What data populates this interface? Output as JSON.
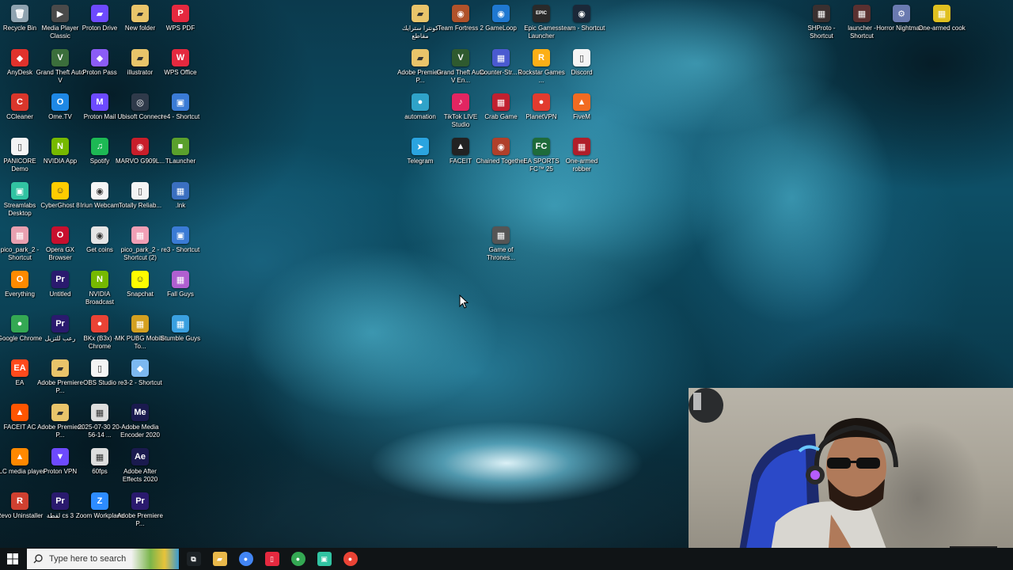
{
  "desktop": {
    "icons": [
      {
        "label": "Recycle Bin",
        "glyph": "🗑",
        "color": "#8fa3b0"
      },
      {
        "label": "AnyDesk",
        "glyph": "◆",
        "color": "#e0322c"
      },
      {
        "label": "CCleaner",
        "glyph": "C",
        "color": "#d9362b"
      },
      {
        "label": "PANICORE Demo",
        "glyph": "▯",
        "color": "#f4f4f4"
      },
      {
        "label": "Streamlabs Desktop",
        "glyph": "▣",
        "color": "#31c3a2"
      },
      {
        "label": "pico_park_2 - Shortcut",
        "glyph": "▦",
        "color": "#e8a0b0"
      },
      {
        "label": "Everything",
        "glyph": "O",
        "color": "#ff8a00"
      },
      {
        "label": "Google Chrome",
        "glyph": "●",
        "color": "#34a853"
      },
      {
        "label": "EA",
        "glyph": "EA",
        "color": "#ff4a1c"
      },
      {
        "label": "FACEIT AC",
        "glyph": "▲",
        "color": "#ff5500"
      },
      {
        "label": "VLC media player",
        "glyph": "▲",
        "color": "#ff8800"
      },
      {
        "label": "Revo Uninstaller",
        "glyph": "R",
        "color": "#d04030"
      },
      {
        "label": "Media Player Classic",
        "glyph": "▶",
        "color": "#4a4a4a"
      },
      {
        "label": "Grand Theft Auto V",
        "glyph": "V",
        "color": "#3b6e3b"
      },
      {
        "label": "Ome.TV",
        "glyph": "O",
        "color": "#1e88e5"
      },
      {
        "label": "NVIDIA App",
        "glyph": "N",
        "color": "#76b900"
      },
      {
        "label": "CyberGhost 8",
        "glyph": "☺",
        "color": "#ffcc00"
      },
      {
        "label": "Opera GX Browser",
        "glyph": "O",
        "color": "#c8102e"
      },
      {
        "label": "Untitled",
        "glyph": "Pr",
        "color": "#2a1a6e"
      },
      {
        "label": "رعب للتزيل",
        "glyph": "Pr",
        "color": "#2a1a6e"
      },
      {
        "label": "Adobe Premiere P...",
        "glyph": "▰",
        "color": "#e9c46a"
      },
      {
        "label": "Adobe Premiere P...",
        "glyph": "▰",
        "color": "#e9c46a"
      },
      {
        "label": "Proton VPN",
        "glyph": "▼",
        "color": "#6d4aff"
      },
      {
        "label": "لقطة cs 3",
        "glyph": "Pr",
        "color": "#2a1a6e"
      },
      {
        "label": "Proton Drive",
        "glyph": "▰",
        "color": "#6d4aff"
      },
      {
        "label": "Proton Pass",
        "glyph": "◆",
        "color": "#8b5cf6"
      },
      {
        "label": "Proton Mail",
        "glyph": "M",
        "color": "#6d4aff"
      },
      {
        "label": "Spotify",
        "glyph": "♫",
        "color": "#1db954"
      },
      {
        "label": "Iriun Webcam",
        "glyph": "◉",
        "color": "#f5f5f5"
      },
      {
        "label": "Get coins",
        "glyph": "◉",
        "color": "#e5e5e5"
      },
      {
        "label": "NVIDIA Broadcast",
        "glyph": "N",
        "color": "#76b900"
      },
      {
        "label": "BKx (B3x) - Chrome",
        "glyph": "●",
        "color": "#ea4335"
      },
      {
        "label": "OBS Studio",
        "glyph": "▯",
        "color": "#f4f4f4"
      },
      {
        "label": "2025-07-30 20-56-14 ...",
        "glyph": "▦",
        "color": "#dddddd"
      },
      {
        "label": "60fps",
        "glyph": "▦",
        "color": "#dddddd"
      },
      {
        "label": "Zoom Workplace",
        "glyph": "Z",
        "color": "#2d8cff"
      },
      {
        "label": "New folder",
        "glyph": "▰",
        "color": "#e9c46a"
      },
      {
        "label": "illustrator",
        "glyph": "▰",
        "color": "#e9c46a"
      },
      {
        "label": "Ubisoft Connect",
        "glyph": "◎",
        "color": "#2f3a4a"
      },
      {
        "label": "MARVO G909L...",
        "glyph": "◉",
        "color": "#c81e2a"
      },
      {
        "label": "Totally Reliab...",
        "glyph": "▯",
        "color": "#f4f4f4"
      },
      {
        "label": "pico_park_2 - Shortcut (2)",
        "glyph": "▦",
        "color": "#f19fb5"
      },
      {
        "label": "Snapchat",
        "glyph": "☺",
        "color": "#fffc00"
      },
      {
        "label": "MK PUBG Mobile To...",
        "glyph": "▦",
        "color": "#d4a020"
      },
      {
        "label": "re3-2 - Shortcut",
        "glyph": "◆",
        "color": "#7cb8f0"
      },
      {
        "label": "Adobe Media Encoder 2020",
        "glyph": "Me",
        "color": "#1a1a4e"
      },
      {
        "label": "Adobe After Effects 2020",
        "glyph": "Ae",
        "color": "#1a1a4e"
      },
      {
        "label": "Adobe Premiere P...",
        "glyph": "Pr",
        "color": "#2a1a6e"
      },
      {
        "label": "WPS PDF",
        "glyph": "P",
        "color": "#e5293f"
      },
      {
        "label": "WPS Office",
        "glyph": "W",
        "color": "#e5293f"
      },
      {
        "label": "re4 - Shortcut",
        "glyph": "▣",
        "color": "#3a7bd5"
      },
      {
        "label": "TLauncher",
        "glyph": "■",
        "color": "#5aa02c"
      },
      {
        "label": ".lnk",
        "glyph": "▦",
        "color": "#3a6fc0"
      },
      {
        "label": "re3 - Shortcut",
        "glyph": "▣",
        "color": "#3a7bd5"
      },
      {
        "label": "Fall Guys",
        "glyph": "▦",
        "color": "#b05fd0"
      },
      {
        "label": "Stumble Guys",
        "glyph": "▦",
        "color": "#3aa0e0"
      },
      {
        "label": "كونترا سترايك مقاطع",
        "glyph": "▰",
        "color": "#e9c46a"
      },
      {
        "label": "Adobe Premiere P...",
        "glyph": "▰",
        "color": "#e9c46a"
      },
      {
        "label": "automation",
        "glyph": "●",
        "color": "#2fa3c9"
      },
      {
        "label": "Telegram",
        "glyph": "➤",
        "color": "#2aa4e0"
      },
      {
        "label": "Team Fortress 2",
        "glyph": "◉",
        "color": "#b0522a"
      },
      {
        "label": "Grand Theft Auto V En...",
        "glyph": "V",
        "color": "#2f5a2f"
      },
      {
        "label": "TikTok LIVE Studio",
        "glyph": "♪",
        "color": "#e22561"
      },
      {
        "label": "FACEIT",
        "glyph": "▲",
        "color": "#222222"
      },
      {
        "label": "GameLoop",
        "glyph": "◉",
        "color": "#1f78d1"
      },
      {
        "label": "Counter-Str... 2",
        "glyph": "▦",
        "color": "#4a5ad0"
      },
      {
        "label": "Crab Game",
        "glyph": "▦",
        "color": "#c02030"
      },
      {
        "label": "Chained Together",
        "glyph": "◉",
        "color": "#b0402a"
      },
      {
        "label": "Game of Thrones...",
        "glyph": "▦",
        "color": "#555555"
      },
      {
        "label": "Epic Games Launcher",
        "glyph": "EPIC",
        "color": "#2a2a2a"
      },
      {
        "label": "Rockstar Games ...",
        "glyph": "R",
        "color": "#fcaf17"
      },
      {
        "label": "PlanetVPN",
        "glyph": "●",
        "color": "#e23b2e"
      },
      {
        "label": "EA SPORTS FC™ 25",
        "glyph": "FC",
        "color": "#1e6b3a"
      },
      {
        "label": "steam - Shortcut",
        "glyph": "◉",
        "color": "#1b2838"
      },
      {
        "label": "Discord",
        "glyph": "▯",
        "color": "#f4f4f4"
      },
      {
        "label": "FiveM",
        "glyph": "▲",
        "color": "#f26b21"
      },
      {
        "label": "One-armed robber",
        "glyph": "▦",
        "color": "#b01e2a"
      },
      {
        "label": "SHProto - Shortcut",
        "glyph": "▦",
        "color": "#3a3030"
      },
      {
        "label": "launcher - Shortcut",
        "glyph": "▦",
        "color": "#5a3030"
      },
      {
        "label": "Horror Nightmar...",
        "glyph": "⚙",
        "color": "#6a7ab0"
      },
      {
        "label": "One-armed cook",
        "glyph": "▦",
        "color": "#e0c020"
      }
    ]
  },
  "taskbar": {
    "start_icon": "windows-logo-icon",
    "search_placeholder": "Type here to search",
    "apps": [
      {
        "name": "task-view-icon",
        "glyph": "⧉",
        "color": "#1c2226"
      },
      {
        "name": "file-explorer-icon",
        "glyph": "▰",
        "color": "#e9b84a"
      },
      {
        "name": "chrome-icon",
        "glyph": "●",
        "color": "#4285f4"
      },
      {
        "name": "document-app-icon",
        "glyph": "▯",
        "color": "#e5293f"
      },
      {
        "name": "chrome-profile-icon",
        "glyph": "●",
        "color": "#34a853"
      },
      {
        "name": "streamlabs-icon",
        "glyph": "▣",
        "color": "#31c3a2"
      },
      {
        "name": "chrome-alt-icon",
        "glyph": "●",
        "color": "#ea4335"
      }
    ]
  }
}
